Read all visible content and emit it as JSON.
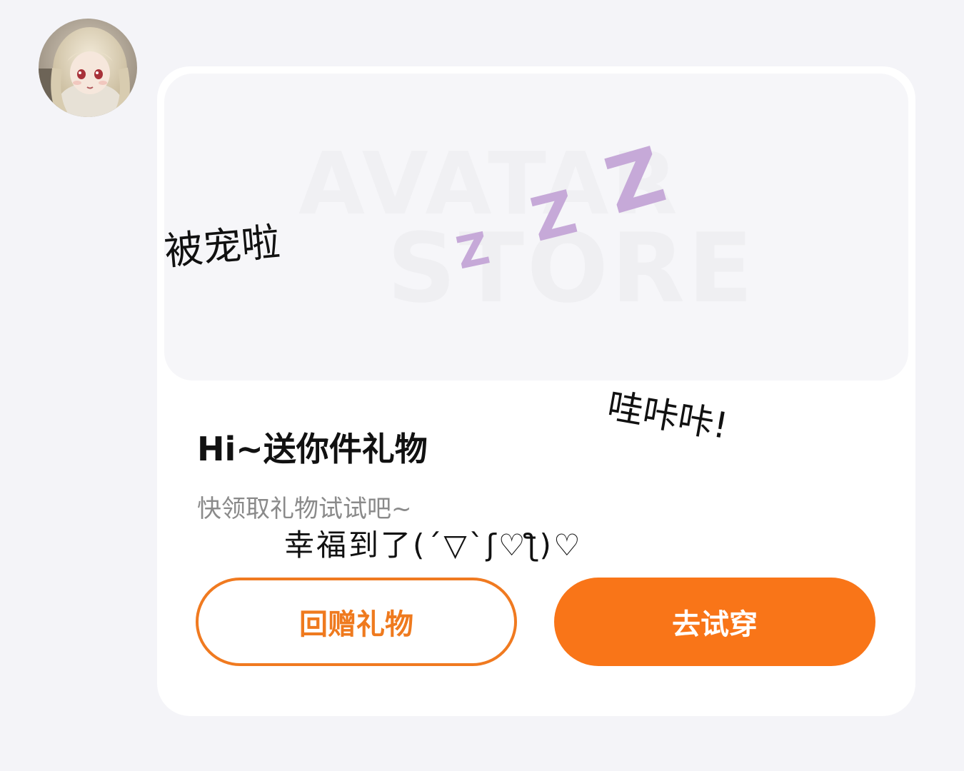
{
  "colors": {
    "accent": "#f97518",
    "outline": "#f07a20",
    "outline_text": "#ef7a1e",
    "solid_text": "#ffffff",
    "zzz": "#c6a9d8"
  },
  "avatar": {
    "icon": "doll-avatar-icon"
  },
  "banner": {
    "watermark_line1": "AVATAR",
    "watermark_line2": "STORE",
    "zzz_icon": "sleeping-zzz-icon",
    "zzz_letters": [
      "Z",
      "Z",
      "Z"
    ]
  },
  "stickers": {
    "left": "被宠啦",
    "right": "哇咔咔!",
    "bottom": "幸福到了(´▽`ʃ♡ƪ)♡"
  },
  "message": {
    "title": "Hi~送你件礼物",
    "subtitle": "快领取礼物试试吧~"
  },
  "buttons": {
    "return_gift": "回赠礼物",
    "try_on": "去试穿"
  }
}
